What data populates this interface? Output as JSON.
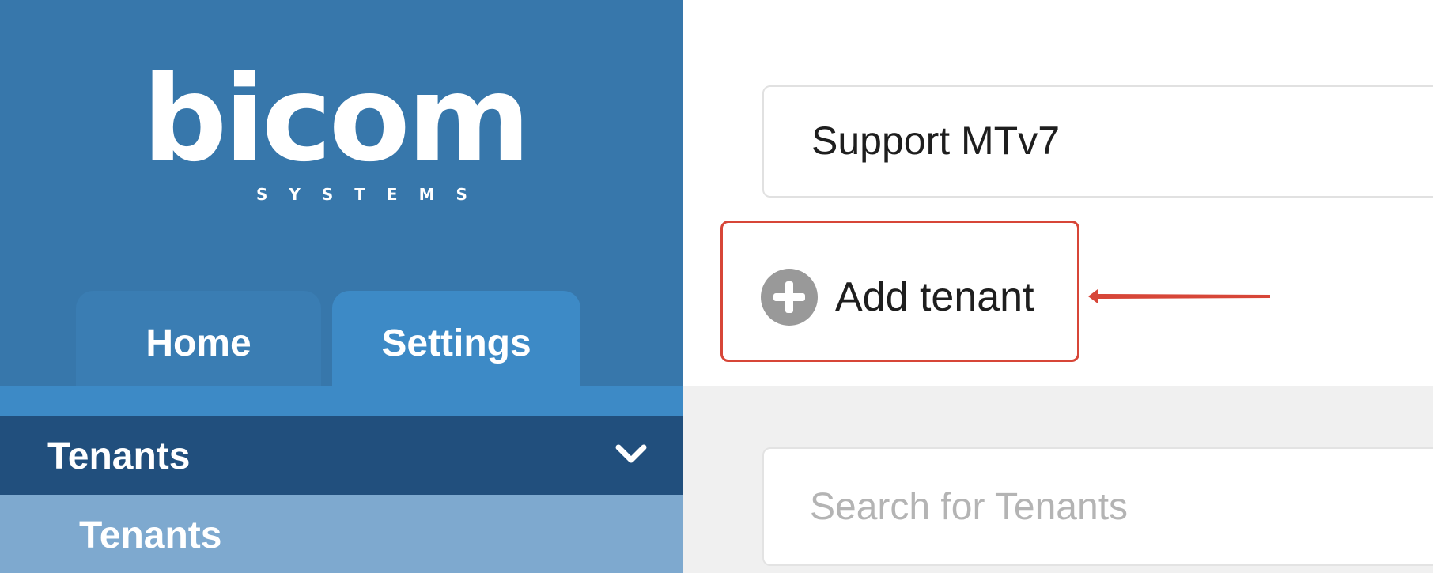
{
  "brand": {
    "name": "bicom",
    "subtitle": "SYSTEMS"
  },
  "tabs": [
    {
      "label": "Home",
      "active": false
    },
    {
      "label": "Settings",
      "active": true
    }
  ],
  "nav": {
    "section_label": "Tenants",
    "section_icon": "chevron-down-icon",
    "items": [
      {
        "label": "Tenants"
      }
    ]
  },
  "tenant_selector": {
    "value": "Support MTv7"
  },
  "actions": {
    "add_tenant_label": "Add tenant",
    "add_icon": "plus-circle-icon"
  },
  "search": {
    "placeholder": "Search for Tenants",
    "value": ""
  },
  "colors": {
    "sidebar_bg": "#3777ab",
    "tab_active_bg": "#3d8ac6",
    "nav_section_bg": "#214f7d",
    "nav_item_bg": "#7ea9cf",
    "highlight": "#d74638",
    "content_gray": "#f0f0f0"
  }
}
